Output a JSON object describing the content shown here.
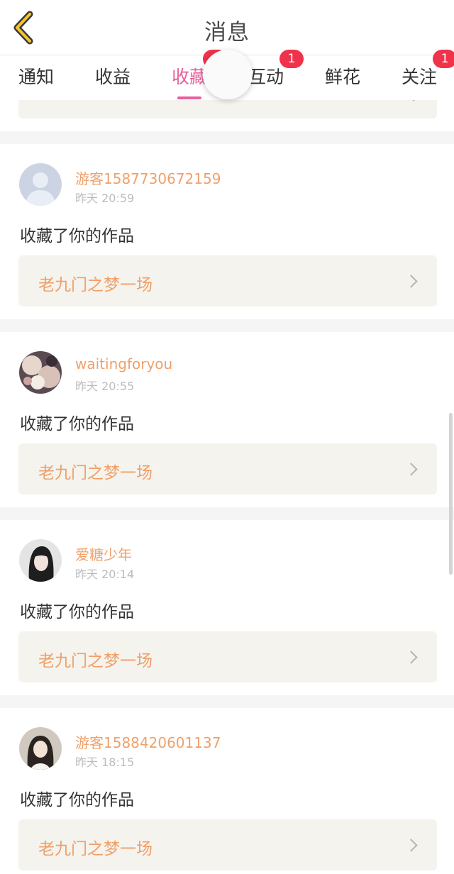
{
  "header": {
    "title": "消息"
  },
  "tabs": [
    {
      "label": "通知"
    },
    {
      "label": "收益"
    },
    {
      "label": "收藏"
    },
    {
      "label": "互动",
      "badge": "1"
    },
    {
      "label": "鲜花"
    },
    {
      "label": "关注",
      "badge": "1"
    }
  ],
  "colors": {
    "accent": "#e8609e",
    "username": "#f0a06a",
    "badge": "#f0324a",
    "work_bg": "#f5f3ed"
  },
  "items": [
    {
      "user": "游客1587730672159",
      "time": "昨天 20:59",
      "action": "收藏了你的作品",
      "work": "老九门之梦一场",
      "avatar": "default-avatar-icon"
    },
    {
      "user": "waitingforyou",
      "time": "昨天 20:55",
      "action": "收藏了你的作品",
      "work": "老九门之梦一场",
      "avatar": "user-avatar-photo"
    },
    {
      "user": "爱糖少年",
      "time": "昨天 20:14",
      "action": "收藏了你的作品",
      "work": "老九门之梦一场",
      "avatar": "user-avatar-photo"
    },
    {
      "user": "游客1588420601137",
      "time": "昨天 18:15",
      "action": "收藏了你的作品",
      "work": "老九门之梦一场",
      "avatar": "user-avatar-photo"
    }
  ]
}
